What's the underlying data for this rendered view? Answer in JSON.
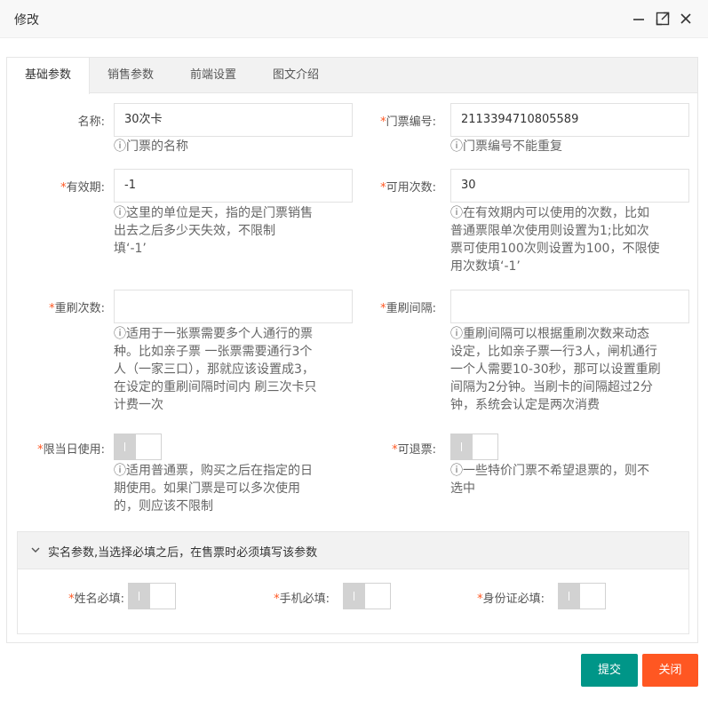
{
  "window": {
    "title": "修改"
  },
  "tabs": [
    "基础参数",
    "销售参数",
    "前端设置",
    "图文介绍"
  ],
  "form": {
    "name": {
      "label": "名称:",
      "value": "30次卡",
      "hint": "ⓘ门票的名称"
    },
    "ticket_no": {
      "label": "门票编号:",
      "value": "2113394710805589",
      "hint": "ⓘ门票编号不能重复"
    },
    "validity": {
      "label": "有效期:",
      "value": "-1",
      "hint": [
        "ⓘ这里的单位是天，指的是门票销售",
        "出去之后多少天失效，不限制",
        "填‘-1’"
      ]
    },
    "uses": {
      "label": "可用次数:",
      "value": "30",
      "hint": [
        "ⓘ在有效期内可以使用的次数，比如",
        "普通票限单次使用则设置为1;比如次",
        "票可使用100次则设置为100，不限使",
        "用次数填‘-1’"
      ]
    },
    "reswipe_count": {
      "label": "重刷次数:",
      "value": "",
      "hint": [
        "ⓘ适用于一张票需要多个人通行的票",
        "种。比如亲子票 一张票需要通行3个",
        "人（一家三口），那就应该设置成3，",
        "在设定的重刷间隔时间内 刷三次卡只",
        "计费一次"
      ]
    },
    "reswipe_interval": {
      "label": "重刷间隔:",
      "value": "",
      "hint": [
        "ⓘ重刷间隔可以根据重刷次数来动态",
        "设定，比如亲子票一行3人，闸机通行",
        "一个人需要10-30秒，那可以设置重刷",
        "间隔为2分钟。当刷卡的间隔超过2分",
        "钟，系统会认定是两次消费"
      ]
    },
    "same_day": {
      "label": "限当日使用:",
      "hint": [
        "ⓘ适用普通票，购买之后在指定的日",
        "期使用。如果门票是可以多次使用",
        "的，则应该不限制"
      ]
    },
    "refundable": {
      "label": "可退票:",
      "hint": [
        "ⓘ一些特价门票不希望退票的，则不",
        "选中"
      ]
    }
  },
  "realname": {
    "title": "实名参数,当选择必填之后，在售票时必须填写该参数",
    "name_required": "姓名必填:",
    "phone_required": "手机必填:",
    "id_required": "身份证必填:"
  },
  "buttons": {
    "submit": "提交",
    "close": "关闭"
  },
  "colors": {
    "submit": "#009688",
    "close": "#ff5722",
    "required": "#ff5722"
  }
}
